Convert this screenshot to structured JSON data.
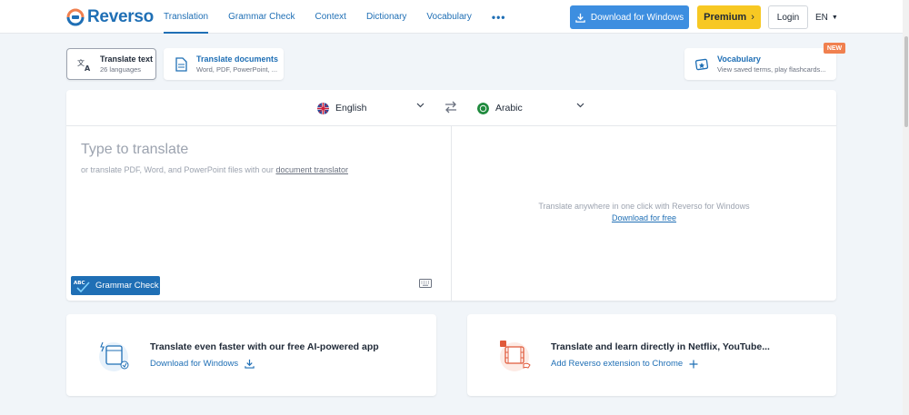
{
  "header": {
    "logo_text": "Reverso",
    "nav": [
      {
        "label": "Translation",
        "active": true
      },
      {
        "label": "Grammar Check",
        "active": false
      },
      {
        "label": "Context",
        "active": false
      },
      {
        "label": "Dictionary",
        "active": false
      },
      {
        "label": "Vocabulary",
        "active": false
      }
    ],
    "more_label": "•••",
    "download_label": "Download for Windows",
    "premium_label": "Premium",
    "login_label": "Login",
    "ui_language": "EN"
  },
  "modes": {
    "text": {
      "title": "Translate text",
      "subtitle": "26 languages"
    },
    "documents": {
      "title": "Translate documents",
      "subtitle": "Word, PDF, PowerPoint, ..."
    },
    "vocabulary": {
      "title": "Vocabulary",
      "subtitle": "View saved terms, play flashcards...",
      "badge": "NEW"
    }
  },
  "translator": {
    "source_language": "English",
    "target_language": "Arabic",
    "placeholder": "Type to translate",
    "hint_prefix": "or translate PDF, Word, and PowerPoint files with our ",
    "hint_link": "document translator",
    "grammar_button": "Grammar Check",
    "target_message": "Translate anywhere in one click with Reverso for Windows",
    "target_link": "Download for free"
  },
  "promos": {
    "left": {
      "title": "Translate even faster with our free AI-powered app",
      "link": "Download for Windows"
    },
    "right": {
      "title": "Translate and learn directly in Netflix, YouTube...",
      "link": "Add Reverso extension to Chrome"
    }
  },
  "colors": {
    "brand_blue": "#1f6fb5",
    "download_blue": "#3d8ee0",
    "premium_yellow": "#f7c823",
    "new_badge": "#f0804f"
  }
}
